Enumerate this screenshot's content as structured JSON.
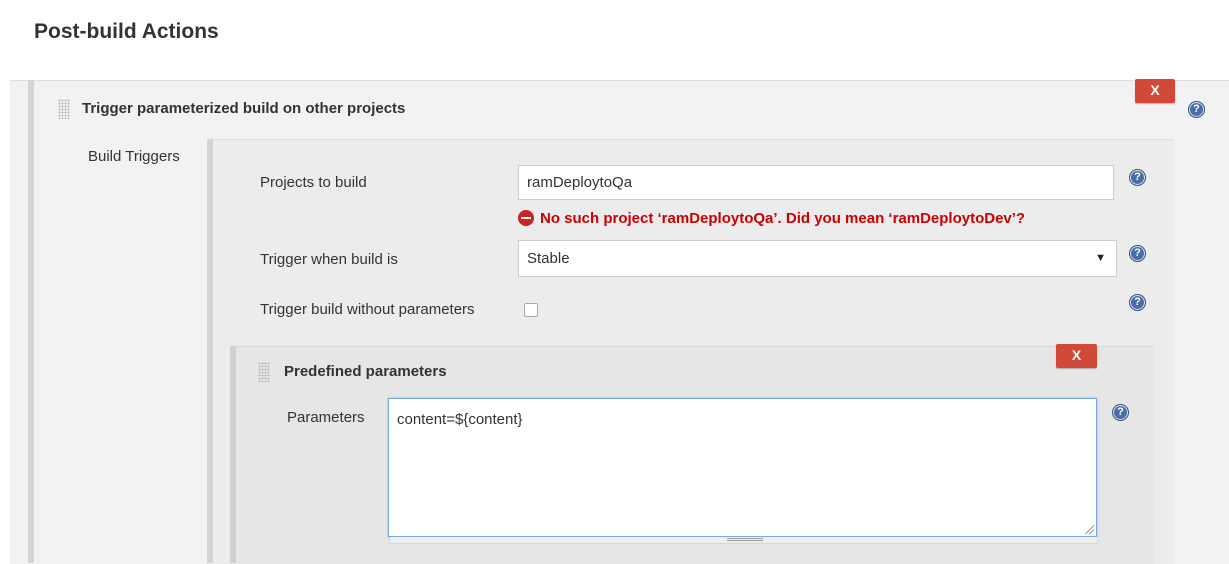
{
  "section": {
    "title": "Post-build Actions"
  },
  "step": {
    "title": "Trigger parameterized build on other projects",
    "delete_label": "X",
    "help_glyph": "?"
  },
  "build_triggers": {
    "label": "Build Triggers",
    "projects": {
      "label": "Projects to build",
      "value": "ramDeploytoQa",
      "error": "No such project ‘ramDeploytoQa’. Did you mean ‘ramDeploytoDev’?"
    },
    "trigger_when": {
      "label": "Trigger when build is",
      "value": "Stable"
    },
    "without_params": {
      "label": "Trigger build without parameters",
      "checked": false
    }
  },
  "predefined": {
    "title": "Predefined parameters",
    "delete_label": "X",
    "params_label": "Parameters",
    "params_value": "content=${content}"
  },
  "colors": {
    "delete_button": "#d24939",
    "error_text": "#cc0000",
    "help_icon": "#4a6ea3"
  }
}
